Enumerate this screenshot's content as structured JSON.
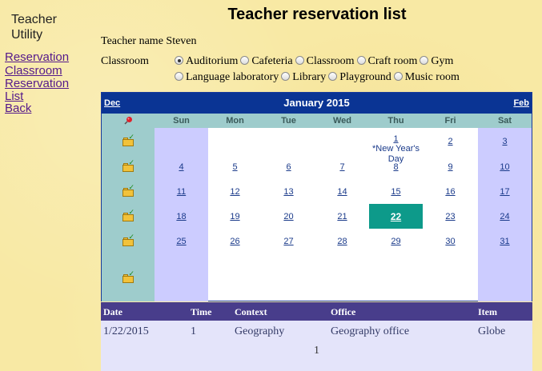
{
  "sidebar": {
    "app_title": "Teacher Utility",
    "links": [
      {
        "label": "Reservation"
      },
      {
        "label": "Classroom Reservation List"
      },
      {
        "label": "Back"
      }
    ]
  },
  "page_title": "Teacher reservation list",
  "teacher": {
    "label": "Teacher name",
    "name": "Steven"
  },
  "classroom": {
    "label": "Classroom",
    "options": [
      "Auditorium",
      "Cafeteria",
      "Classroom",
      "Craft room",
      "Gym",
      "Language laboratory",
      "Library",
      "Playground",
      "Music room"
    ],
    "selected": "Auditorium"
  },
  "calendar": {
    "prev_label": "Dec",
    "next_label": "Feb",
    "month_title": "January 2015",
    "weekdays": [
      "Sun",
      "Mon",
      "Tue",
      "Wed",
      "Thu",
      "Fri",
      "Sat"
    ],
    "weeks": [
      [
        "",
        "",
        "",
        "",
        "1",
        "2",
        "3"
      ],
      [
        "4",
        "5",
        "6",
        "7",
        "8",
        "9",
        "10"
      ],
      [
        "11",
        "12",
        "13",
        "14",
        "15",
        "16",
        "17"
      ],
      [
        "18",
        "19",
        "20",
        "21",
        "22",
        "23",
        "24"
      ],
      [
        "25",
        "26",
        "27",
        "28",
        "29",
        "30",
        "31"
      ],
      [
        "",
        "",
        "",
        "",
        "",
        "",
        ""
      ]
    ],
    "today": "22",
    "notes": {
      "1": "*New Year's Day"
    },
    "pin_icon": "pushpin-icon",
    "week_icon": "folder-check-icon"
  },
  "reservations": {
    "columns": [
      "Date",
      "Time",
      "Context",
      "Office",
      "Item"
    ],
    "rows": [
      [
        "1/22/2015",
        "1",
        "Geography",
        "Geography office",
        "Globe"
      ]
    ],
    "page": "1"
  },
  "colors": {
    "background": "#f8e9a4",
    "calendar_header": "#0a3494",
    "weekday_row": "#9ecccc",
    "weekend": "#ccccff",
    "today": "#0d9a8a",
    "table_header": "#483d8b",
    "table_row": "#e4e4fa"
  }
}
